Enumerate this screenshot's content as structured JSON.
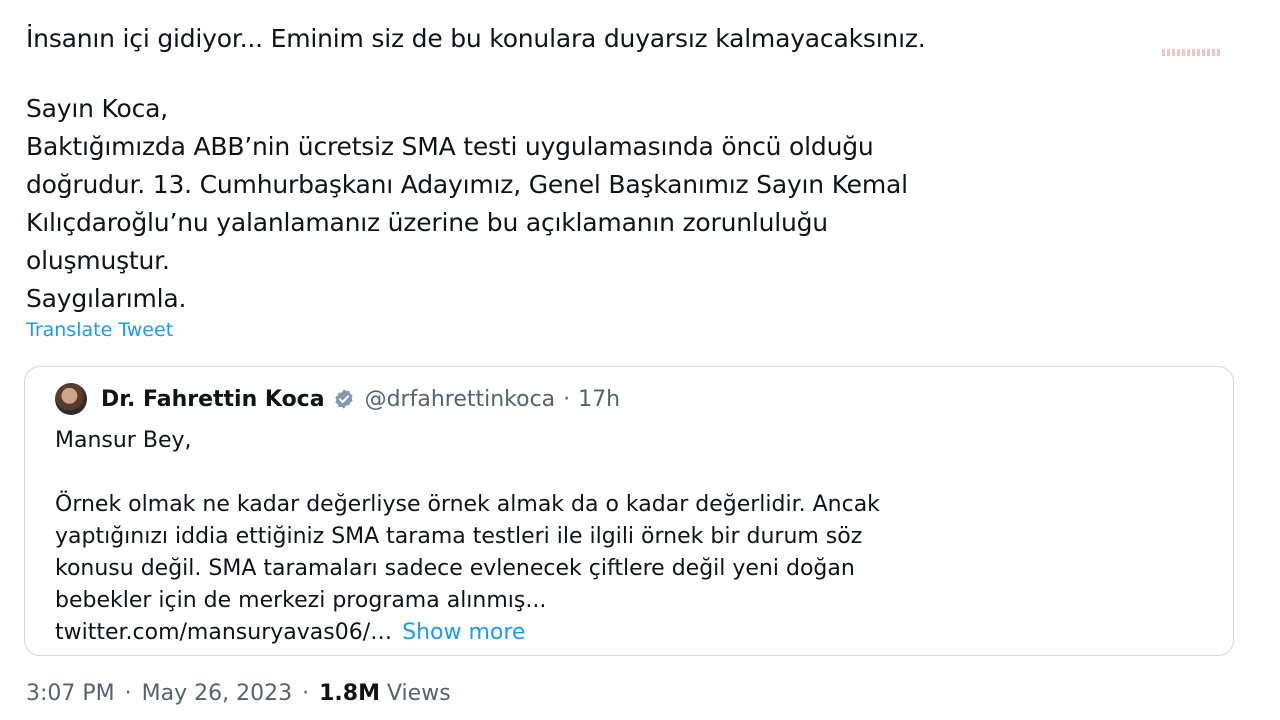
{
  "tweet": {
    "top_line": "İnsanın içi gidiyor... Eminim siz de bu konulara duyarsız kalmayacaksınız.",
    "body_lines": [
      "Sayın Koca,",
      "Baktığımızda ABB’nin ücretsiz SMA testi uygulamasında öncü olduğu",
      "doğrudur. 13. Cumhurbaşkanı Adayımız, Genel Başkanımız Sayın Kemal",
      "Kılıçdaroğlu’nu yalanlamanız üzerine bu açıklamanın zorunluluğu",
      "oluşmuştur.",
      "Saygılarımla."
    ],
    "translate_label": "Translate Tweet"
  },
  "quote": {
    "name": "Dr. Fahrettin Koca",
    "handle": "@drfahrettinkoca",
    "dot": "·",
    "time": "17h",
    "greeting": "Mansur Bey,",
    "body_lines": [
      "Örnek olmak ne kadar değerliyse örnek almak da o kadar değerlidir. Ancak",
      "yaptığınızı iddia ettiğiniz SMA tarama testleri ile ilgili örnek bir durum söz",
      "konusu değil. SMA taramaları sadece evlenecek çiftlere değil yeni doğan",
      "bebekler için de merkezi programa alınmış..."
    ],
    "link_text": "twitter.com/mansuryavas06/…",
    "show_more": "Show more",
    "verified_color": "#829aab"
  },
  "meta": {
    "time": "3:07 PM",
    "dot": "·",
    "date": "May 26, 2023",
    "views_count": "1.8M",
    "views_label": "Views"
  },
  "colors": {
    "text": "#0f1419",
    "secondary": "#536471",
    "link": "#1d9bf0",
    "border": "#cfd9de"
  }
}
